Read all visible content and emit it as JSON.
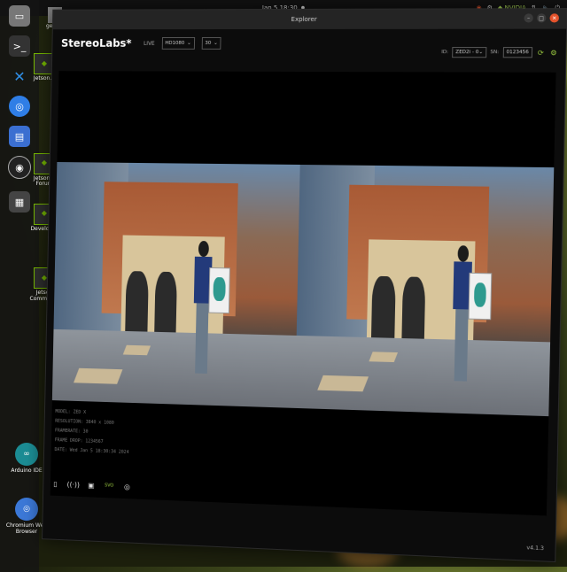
{
  "topbar": {
    "clock": "Jan 5  18:30",
    "tray_label": "NVIDIA"
  },
  "dock": {
    "icons": [
      "files-icon",
      "terminal-icon",
      "vscode-icon",
      "chrome-icon",
      "text-editor-icon",
      "obs-icon",
      "apps-grid-icon"
    ]
  },
  "desktop": {
    "shortcut_top": "gembe",
    "items": [
      {
        "label": "Jetson..."
      },
      {
        "label": "Jetson S Forum"
      },
      {
        "label": "Developer"
      },
      {
        "label": "Jetson Commun..."
      }
    ],
    "arduino": "Arduino IDE",
    "chromium": "Chromium Web Browser"
  },
  "window": {
    "title": "Explorer",
    "brand": "StereoLabs*",
    "live_label": "LIVE",
    "resolution_select": "HD1080",
    "fps_select": "30",
    "id_label": "ID:",
    "camera_select": "ZED2i - 0",
    "sn_label": "SN:",
    "sn_value": "0123456",
    "meta": {
      "model": "MODEL: ZED X",
      "resolution": "RESOLUTION: 3840 x 1080",
      "framerate": "FRAMERATE: 30",
      "frame_drop": "FRAME DROP: 1234567",
      "date": "DATE: Wed Jan 5 18:30:34 2024"
    },
    "version": "v4.1.3"
  }
}
